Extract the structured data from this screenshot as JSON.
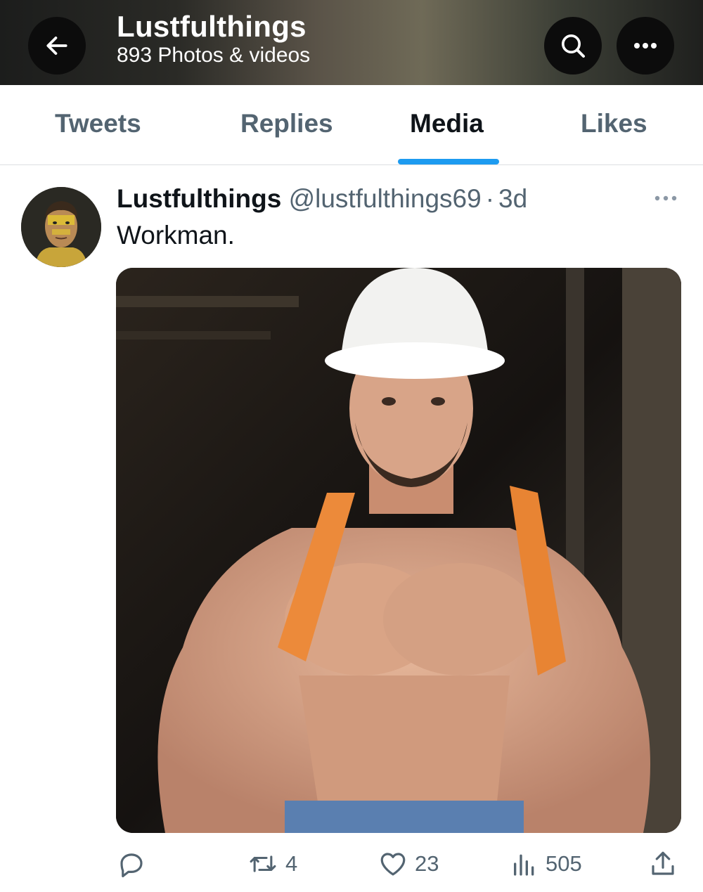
{
  "header": {
    "title": "Lustfulthings",
    "subtitle": "893 Photos & videos",
    "back_icon": "arrow-left-icon",
    "search_icon": "search-icon",
    "more_icon": "more-horizontal-icon"
  },
  "tabs": [
    {
      "label": "Tweets",
      "active": false
    },
    {
      "label": "Replies",
      "active": false
    },
    {
      "label": "Media",
      "active": true
    },
    {
      "label": "Likes",
      "active": false
    }
  ],
  "tweet": {
    "display_name": "Lustfulthings",
    "handle": "@lustfulthings69",
    "separator": "·",
    "time": "3d",
    "text": "Workman.",
    "actions": {
      "replies": "",
      "retweets": "4",
      "likes": "23",
      "views": "505"
    }
  },
  "colors": {
    "accent": "#1d9bf0",
    "secondary_text": "#536471",
    "primary_text": "#0f1419"
  }
}
